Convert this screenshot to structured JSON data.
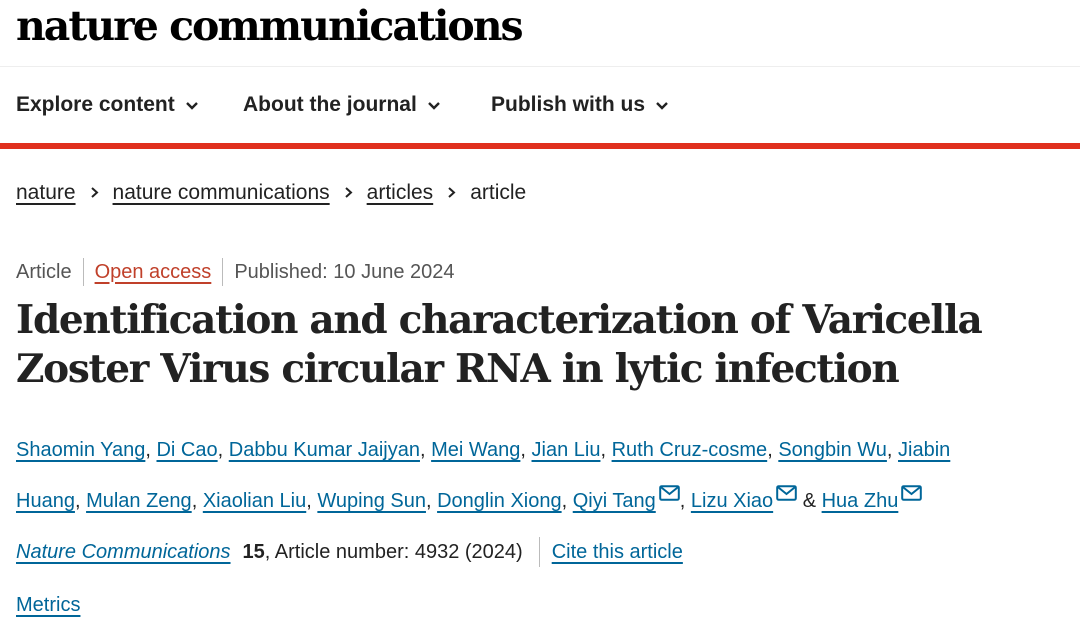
{
  "header": {
    "logo": "nature communications"
  },
  "nav": [
    {
      "label": "Explore content",
      "icon": "chevron-down-icon"
    },
    {
      "label": "About the journal",
      "icon": "chevron-down-icon"
    },
    {
      "label": "Publish with us",
      "icon": "chevron-down-icon"
    }
  ],
  "breadcrumb": [
    {
      "label": "nature"
    },
    {
      "label": "nature communications"
    },
    {
      "label": "articles"
    },
    {
      "label": "article"
    }
  ],
  "article": {
    "type": "Article",
    "access": "Open access",
    "published": "Published: 10 June 2024",
    "title": "Identification and characterization of Varicella Zoster Virus circular RNA in lytic infection",
    "authors": [
      {
        "name": "Shaomin Yang",
        "sep": ", "
      },
      {
        "name": "Di Cao",
        "sep": ", "
      },
      {
        "name": "Dabbu Kumar Jaijyan",
        "sep": ", "
      },
      {
        "name": "Mei Wang",
        "sep": ", "
      },
      {
        "name": "Jian Liu",
        "sep": ", "
      },
      {
        "name": "Ruth Cruz-cosme",
        "sep": ", "
      },
      {
        "name": "Songbin Wu",
        "sep": ", "
      },
      {
        "name": "Jiabin Huang",
        "sep": ", "
      },
      {
        "name": "Mulan Zeng",
        "sep": ", "
      },
      {
        "name": "Xiaolian Liu",
        "sep": ", "
      },
      {
        "name": "Wuping Sun",
        "sep": ", "
      },
      {
        "name": "Donglin Xiong",
        "sep": ", "
      },
      {
        "name": "Qiyi Tang",
        "sep": ", ",
        "mail": true
      },
      {
        "name": "Lizu Xiao",
        "sep": " & ",
        "mail": true
      },
      {
        "name": "Hua Zhu",
        "sep": "",
        "mail": true
      }
    ],
    "journal": "Nature Communications",
    "volume": "15",
    "article_number": ", Article number: 4932 (2024)",
    "cite_label": "Cite this article",
    "metrics_label": "Metrics"
  },
  "colors": {
    "accent_red": "#e0301e",
    "link_blue": "#006699",
    "open_access": "#c0402a"
  }
}
